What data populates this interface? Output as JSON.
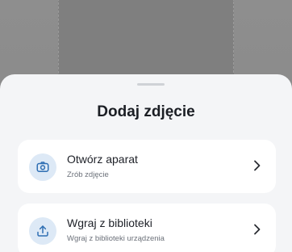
{
  "sheet": {
    "title": "Dodaj zdjęcie",
    "options": [
      {
        "icon": "camera-icon",
        "title": "Otwórz aparat",
        "subtitle": "Zrób zdjęcie"
      },
      {
        "icon": "upload-icon",
        "title": "Wgraj z biblioteki",
        "subtitle": "Wgraj z biblioteki urządzenia"
      }
    ]
  },
  "colors": {
    "accent": "#2f6fb3",
    "icon_background": "#dde9f6",
    "sheet_background": "#f4f5f7",
    "backdrop": "#8a8a8a"
  }
}
